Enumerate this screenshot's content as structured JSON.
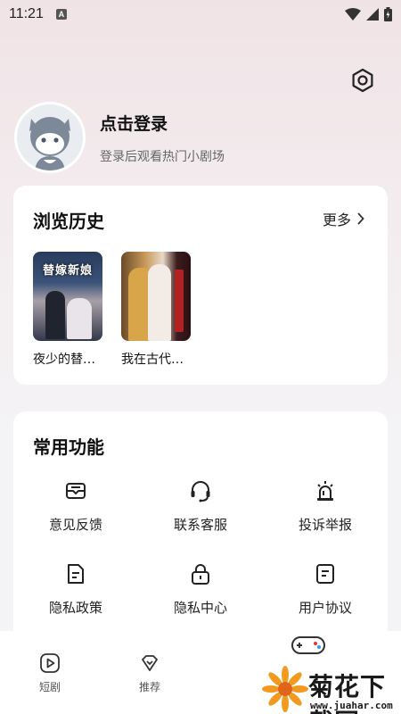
{
  "status_bar": {
    "time": "11:21",
    "indicator": "A"
  },
  "profile": {
    "login_title": "点击登录",
    "login_subtitle": "登录后观看热门小剧场"
  },
  "history": {
    "title": "浏览历史",
    "more_label": "更多",
    "items": [
      {
        "name": "夜少的替…",
        "poster_text": "替嫁新娘"
      },
      {
        "name": "我在古代…"
      }
    ]
  },
  "functions": {
    "title": "常用功能",
    "items": [
      {
        "label": "意见反馈",
        "icon": "feedback-icon"
      },
      {
        "label": "联系客服",
        "icon": "headset-icon"
      },
      {
        "label": "投诉举报",
        "icon": "alarm-icon"
      },
      {
        "label": "隐私政策",
        "icon": "document-icon"
      },
      {
        "label": "隐私中心",
        "icon": "lock-icon"
      },
      {
        "label": "用户协议",
        "icon": "agreement-icon"
      }
    ]
  },
  "bottom_nav": {
    "items": [
      {
        "label": "短剧",
        "icon": "play-icon"
      },
      {
        "label": "推荐",
        "icon": "heart-icon"
      }
    ]
  },
  "watermark": {
    "title": "菊花下载网",
    "url": "www.juahar.com"
  }
}
